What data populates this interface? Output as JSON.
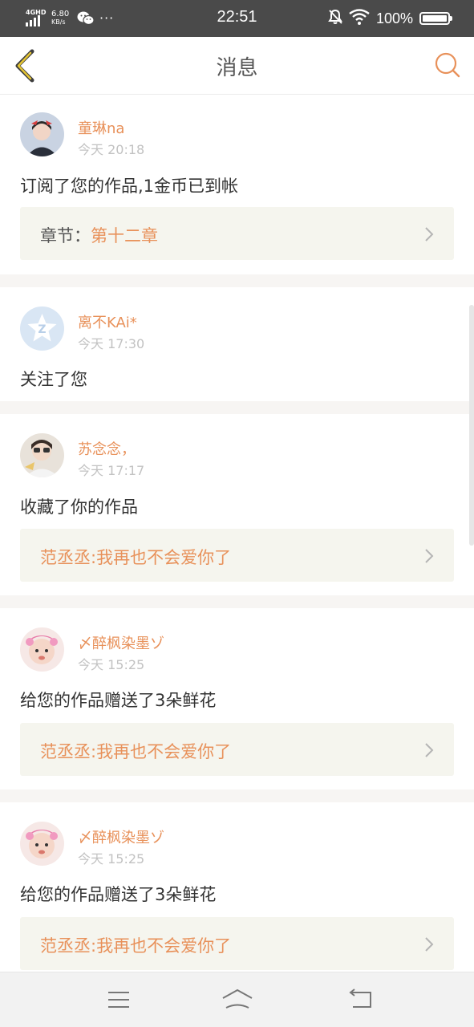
{
  "status_bar": {
    "network": "4GHD",
    "speed_value": "6.80",
    "speed_unit": "KB/s",
    "dots": "···",
    "time": "22:51",
    "battery": "100%",
    "icons": [
      "signal-icon",
      "wechat-icon",
      "mute-bell-icon",
      "wifi-icon",
      "battery-icon"
    ]
  },
  "nav": {
    "title": "消息",
    "back_icon": "back-chevron-icon",
    "search_icon": "search-icon",
    "accent": "#e8915a",
    "back_color": "#c9a227"
  },
  "messages": [
    {
      "user": "童琳na",
      "time": "今天 20:18",
      "text": "订阅了您的作品,1金币已到帐",
      "ref": {
        "label": "章节：",
        "value": "第十二章"
      }
    },
    {
      "user": "离不KAi*",
      "time": "今天 17:30",
      "text": "关注了您"
    },
    {
      "user": "苏念念，",
      "time": "今天 17:17",
      "text": "收藏了你的作品",
      "ref": {
        "label": "",
        "value": "范丞丞:我再也不会爱你了"
      }
    },
    {
      "user": "〆醉枫染墨ゾ",
      "time": "今天 15:25",
      "text": "给您的作品赠送了3朵鲜花",
      "ref": {
        "label": "",
        "value": "范丞丞:我再也不会爱你了"
      }
    },
    {
      "user": "〆醉枫染墨ゾ",
      "time": "今天 15:25",
      "text": "给您的作品赠送了3朵鲜花",
      "ref": {
        "label": "",
        "value": "范丞丞:我再也不会爱你了"
      }
    }
  ],
  "bottom_nav": {
    "icons": [
      "menu-icon",
      "home-icon",
      "back-icon"
    ]
  }
}
